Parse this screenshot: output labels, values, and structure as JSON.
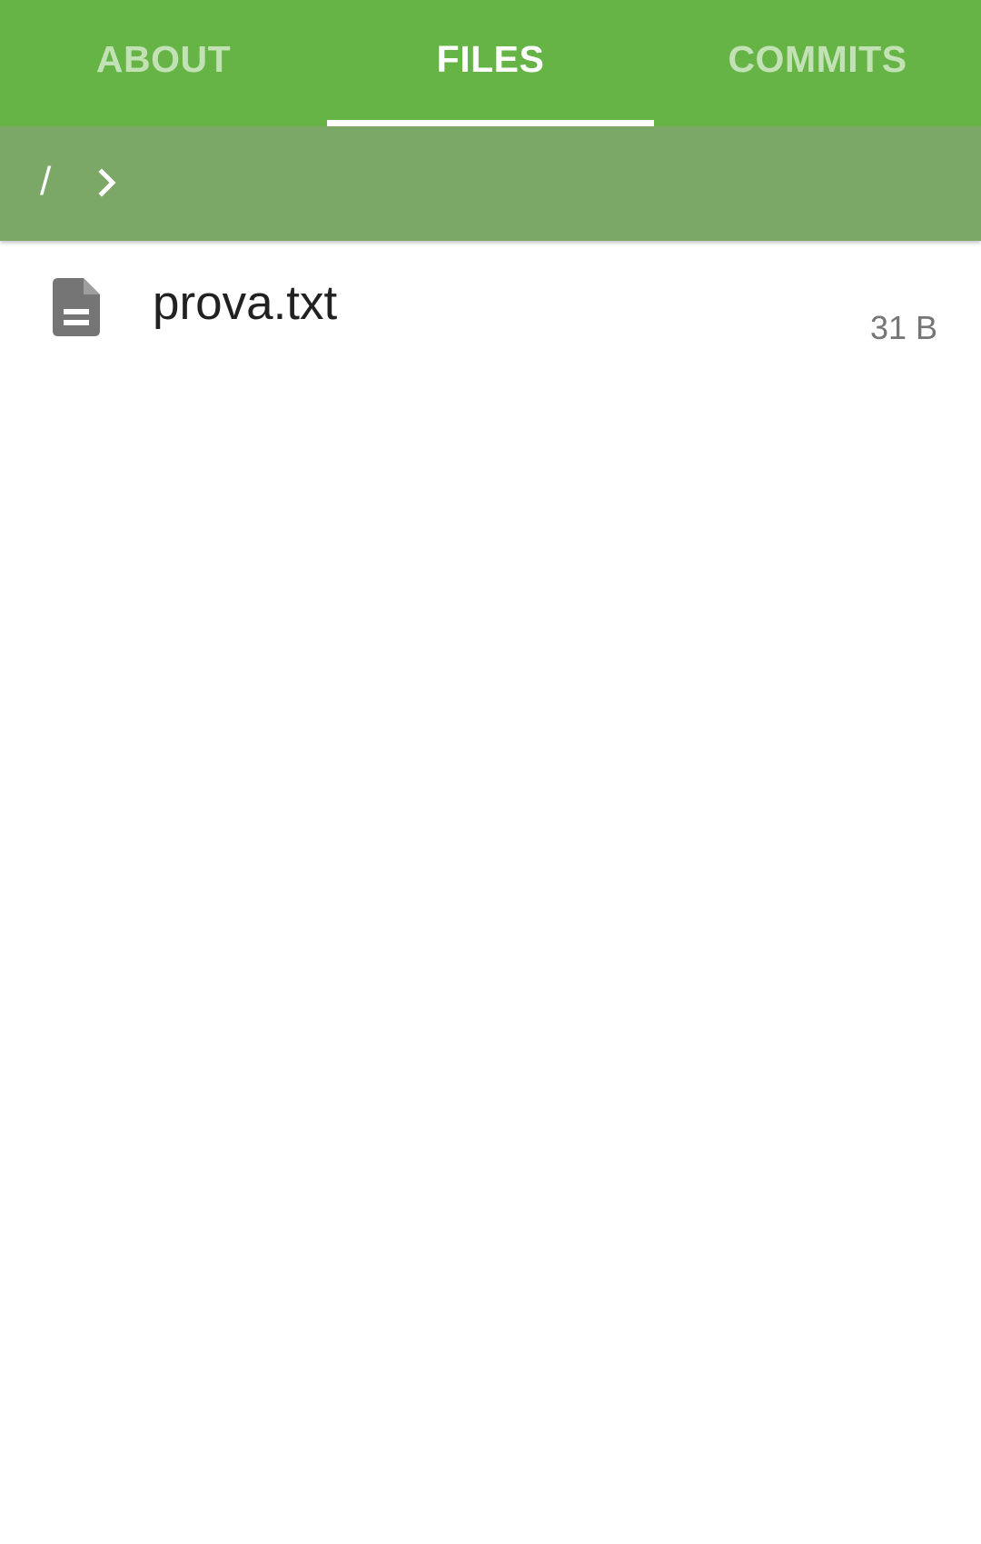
{
  "tabs": [
    {
      "label": "ABOUT",
      "active": false
    },
    {
      "label": "FILES",
      "active": true
    },
    {
      "label": "COMMITS",
      "active": false
    }
  ],
  "breadcrumb": {
    "root": "/",
    "separator_icon": "chevron-right-icon"
  },
  "files": [
    {
      "name": "prova.txt",
      "size": "31 B",
      "icon": "file-document-icon"
    }
  ],
  "colors": {
    "tabbar": "#66b446",
    "breadcrumb_bar": "#7ba866",
    "file_icon": "#757575"
  }
}
